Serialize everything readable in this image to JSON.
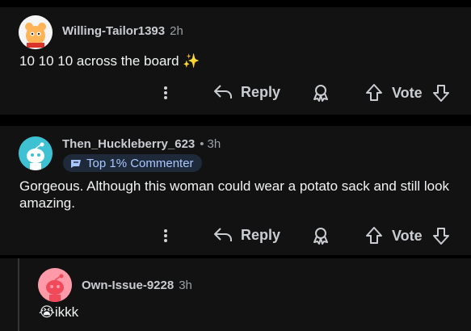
{
  "comments": [
    {
      "username": "Willing-Tailor1393",
      "time": "2h",
      "body": "10 10 10 across the board ✨",
      "actions": {
        "reply": "Reply",
        "vote": "Vote"
      }
    },
    {
      "username": "Then_Huckleberry_623",
      "separator": "•",
      "time": "3h",
      "badge": "Top 1% Commenter",
      "body": "Gorgeous. Although this woman could wear a potato sack and still look amazing.",
      "actions": {
        "reply": "Reply",
        "vote": "Vote"
      }
    },
    {
      "username": "Own-Issue-9228",
      "time": "3h",
      "emoji": "😭",
      "body": "ikkk"
    }
  ],
  "colors": {
    "background": "#000000",
    "card": "#121212",
    "text": "#f1f3f4",
    "muted": "#9aa0a6",
    "badge_bg": "#1e2a3a",
    "badge_text": "#a9c7ff"
  }
}
